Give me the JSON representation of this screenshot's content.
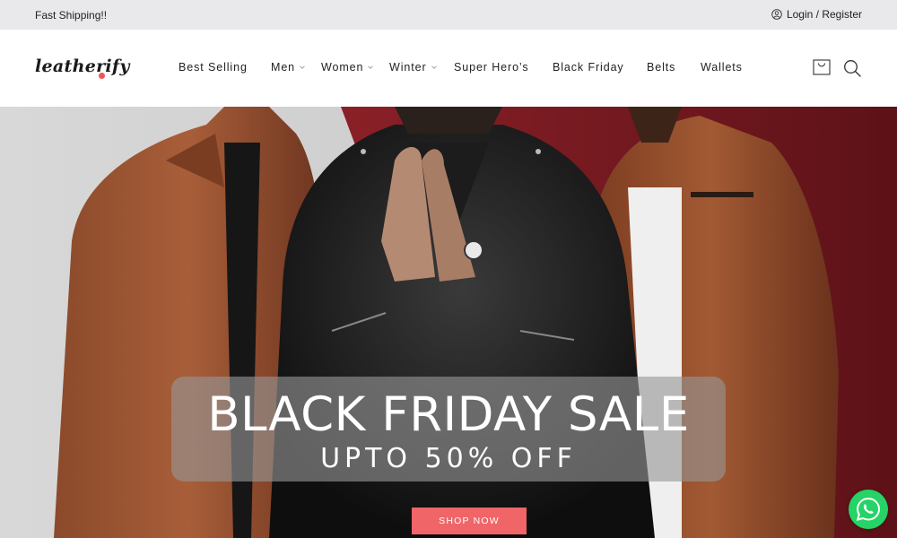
{
  "topbar": {
    "promo_text": "Fast Shipping!!",
    "login_text": "Login / Register"
  },
  "header": {
    "logo_text": "leatherify",
    "nav": [
      {
        "label": "Best Selling",
        "has_dropdown": false
      },
      {
        "label": "Men",
        "has_dropdown": true
      },
      {
        "label": "Women",
        "has_dropdown": true
      },
      {
        "label": "Winter",
        "has_dropdown": true
      },
      {
        "label": "Super Hero’s",
        "has_dropdown": false
      },
      {
        "label": "Black Friday",
        "has_dropdown": false
      },
      {
        "label": "Belts",
        "has_dropdown": false
      },
      {
        "label": "Wallets",
        "has_dropdown": false
      }
    ],
    "icons": [
      "cart-icon",
      "search-icon"
    ]
  },
  "hero": {
    "title": "BLACK FRIDAY SALE",
    "subtitle": "UPTO 50% OFF",
    "cta_label": "SHOP NOW"
  },
  "colors": {
    "accent": "#ef6568",
    "logo_dot": "#f0545a",
    "topbar_bg": "#e9e8ea",
    "hero_maroon": "#6b1a1f",
    "whatsapp": "#25d366"
  },
  "floating": {
    "whatsapp_icon": "whatsapp-icon"
  }
}
